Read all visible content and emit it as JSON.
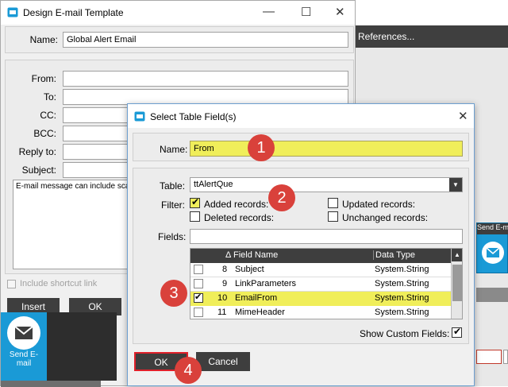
{
  "background": {
    "references_label": "References...",
    "send_email_side_label": "Send E-m",
    "send_email_button": "Send E-\nmail"
  },
  "design_window": {
    "title": "Design E-mail Template",
    "name_label": "Name:",
    "name_value": "Global Alert Email",
    "fields": [
      {
        "label": "From:"
      },
      {
        "label": "To:"
      },
      {
        "label": "CC:"
      },
      {
        "label": "BCC:"
      },
      {
        "label": "Reply to:"
      },
      {
        "label": "Subject:"
      }
    ],
    "body_text": "E-mail message can include sca",
    "include_shortcut_label": "Include shortcut link",
    "insert_label": "Insert",
    "ok_label": "OK"
  },
  "dialog": {
    "title": "Select Table Field(s)",
    "name_label": "Name:",
    "name_value": "From",
    "table_label": "Table:",
    "table_value": "ttAlertQue",
    "filter_label": "Filter:",
    "filters": {
      "added": {
        "label": "Added records:",
        "checked": true
      },
      "updated": {
        "label": "Updated records:",
        "checked": false
      },
      "deleted": {
        "label": "Deleted records:",
        "checked": false
      },
      "unchanged": {
        "label": "Unchanged records:",
        "checked": false
      }
    },
    "fields_label": "Fields:",
    "grid": {
      "sort_glyph": "Δ",
      "col_field": "Field Name",
      "col_type": "Data Type",
      "rows": [
        {
          "num": "8",
          "field": "Subject",
          "type": "System.String",
          "checked": false
        },
        {
          "num": "9",
          "field": "LinkParameters",
          "type": "System.String",
          "checked": false
        },
        {
          "num": "10",
          "field": "EmailFrom",
          "type": "System.String",
          "checked": true
        },
        {
          "num": "11",
          "field": "MimeHeader",
          "type": "System.String",
          "checked": false
        }
      ]
    },
    "show_custom_label": "Show Custom Fields:",
    "ok_label": "OK",
    "cancel_label": "Cancel"
  },
  "callouts": [
    "1",
    "2",
    "3",
    "4"
  ],
  "colors": {
    "accent": "#1a9ad6",
    "highlight": "#f0ee5a",
    "badge": "#d9413b",
    "dark": "#3e3e3e"
  }
}
